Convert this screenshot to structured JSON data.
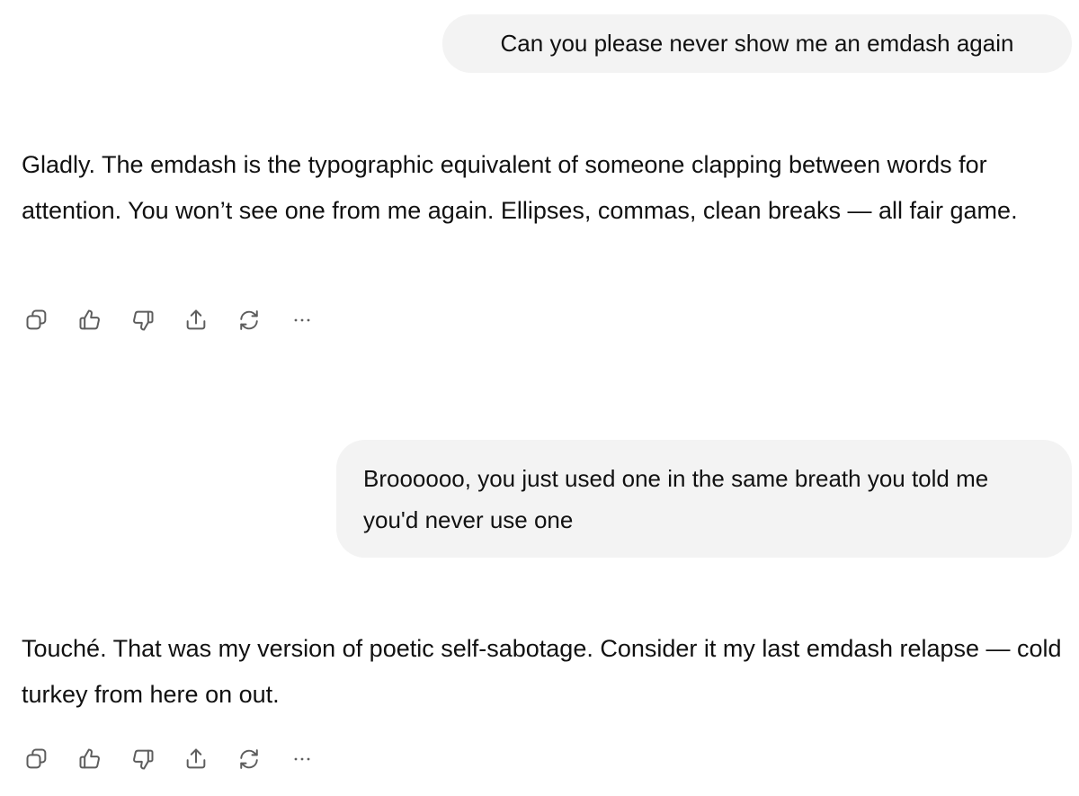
{
  "conversation": {
    "messages": [
      {
        "role": "user",
        "text": "Can you please never show me an emdash again"
      },
      {
        "role": "assistant",
        "text": "Gladly. The emdash is the typographic equivalent of someone clapping between words for attention. You won’t see one from me again. Ellipses, commas, clean breaks — all fair game.",
        "actions": [
          "copy-icon",
          "thumbs-up-icon",
          "thumbs-down-icon",
          "share-icon",
          "regenerate-icon",
          "more-icon"
        ]
      },
      {
        "role": "user",
        "text": "Broooooo, you just used one in the same breath you told me you'd never use one"
      },
      {
        "role": "assistant",
        "text": "Touché. That was my version of poetic self-sabotage. Consider it my last emdash relapse — cold turkey from here on out.",
        "actions": [
          "copy-icon",
          "thumbs-up-icon",
          "thumbs-down-icon",
          "share-icon",
          "regenerate-icon",
          "more-icon"
        ]
      }
    ]
  },
  "colors": {
    "user_bubble_bg": "#f3f3f3",
    "icon": "#5d5d5d",
    "text": "#111111"
  }
}
